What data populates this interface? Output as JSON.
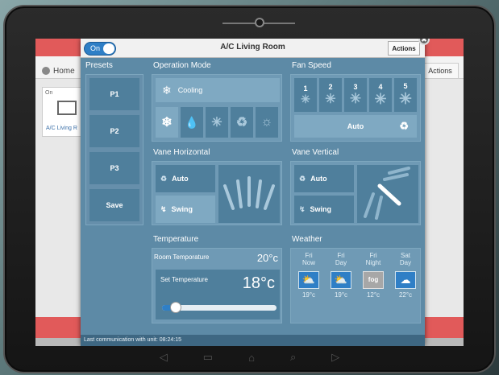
{
  "background": {
    "home_label": "Home",
    "actions_label": "Actions",
    "tile": {
      "status": "On",
      "name": "A/C Living R"
    }
  },
  "dialog": {
    "power_toggle": "On",
    "title": "A/C Living Room",
    "actions_label": "Actions",
    "close_glyph": "✖"
  },
  "presets": {
    "title": "Presets",
    "items": [
      "P1",
      "P2",
      "P3"
    ],
    "save_label": "Save"
  },
  "operation_mode": {
    "title": "Operation Mode",
    "current": "Cooling",
    "modes": [
      "cooling-icon",
      "drop-icon",
      "snowflake-icon",
      "recycle-icon",
      "sun-icon"
    ]
  },
  "fan_speed": {
    "title": "Fan Speed",
    "speeds": [
      "1",
      "2",
      "3",
      "4",
      "5"
    ],
    "auto_label": "Auto"
  },
  "vane_horizontal": {
    "title": "Vane Horizontal",
    "auto_label": "Auto",
    "swing_label": "Swing"
  },
  "vane_vertical": {
    "title": "Vane Vertical",
    "auto_label": "Auto",
    "swing_label": "Swing"
  },
  "temperature": {
    "title": "Temperature",
    "room_label": "Room Temporature",
    "room_value": "20°c",
    "set_label": "Set Temperature",
    "set_value": "18°c",
    "slider_fraction": 0.12
  },
  "weather": {
    "title": "Weather",
    "days": [
      {
        "day": "Fri",
        "period": "Now",
        "icon": "cloud-sun-rain-icon",
        "temp": "19°c"
      },
      {
        "day": "Fri",
        "period": "Day",
        "icon": "cloud-sun-rain-icon",
        "temp": "19°c"
      },
      {
        "day": "Fri",
        "period": "Night",
        "icon": "fog-icon",
        "icon_text": "fog",
        "temp": "12°c"
      },
      {
        "day": "Sat",
        "period": "Day",
        "icon": "cloud-icon",
        "temp": "22°c"
      }
    ]
  },
  "status": "Last communication with unit: 08:24:15",
  "softkeys": [
    "◁",
    "▭",
    "⌂",
    "⌕",
    "▷"
  ]
}
